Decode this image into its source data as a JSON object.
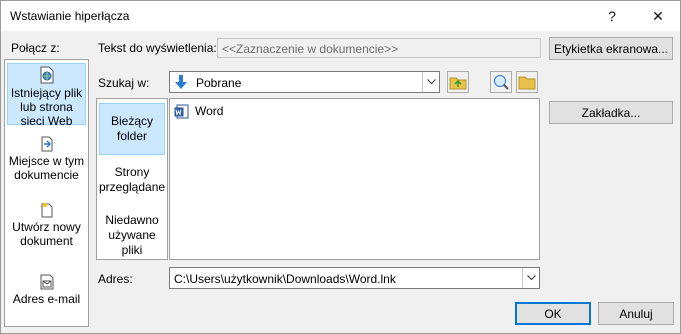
{
  "dialog": {
    "title": "Wstawianie hiperłącza",
    "help_icon": "?",
    "close_icon": "✕"
  },
  "link_to": {
    "label": "Połącz z:",
    "items": [
      {
        "name": "existing-file",
        "label": "Istniejący plik lub strona sieci Web",
        "icon": "globe-file-icon",
        "selected": true
      },
      {
        "name": "place-in-document",
        "label": "Miejsce w tym dokumencie",
        "icon": "document-arrow-icon",
        "selected": false
      },
      {
        "name": "create-new",
        "label": "Utwórz nowy dokument",
        "icon": "new-document-icon",
        "selected": false
      },
      {
        "name": "email",
        "label": "Adres e-mail",
        "icon": "email-icon",
        "selected": false
      }
    ]
  },
  "display_text": {
    "label": "Tekst do wyświetlenia:",
    "value": "<<Zaznaczenie w dokumencie>>"
  },
  "screentip_button": "Etykietka ekranowa...",
  "look_in": {
    "label": "Szukaj w:",
    "value": "Pobrane"
  },
  "subnav": {
    "items": [
      {
        "label": "Bieżący folder",
        "selected": true
      },
      {
        "label": "Strony przeglądane",
        "selected": false
      },
      {
        "label": "Niedawno używane pliki",
        "selected": false
      }
    ]
  },
  "files": [
    {
      "name": "Word",
      "icon": "word-shortcut-icon"
    }
  ],
  "bookmark_button": "Zakładka...",
  "address": {
    "label": "Adres:",
    "value": "C:\\Users\\użytkownik\\Downloads\\Word.lnk"
  },
  "ok_button": "OK",
  "cancel_button": "Anuluj",
  "colors": {
    "selection_bg": "#cce8ff",
    "selection_border": "#99d1ff",
    "accent": "#0078d7"
  }
}
